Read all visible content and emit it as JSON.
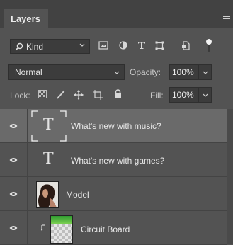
{
  "panel": {
    "tab_label": "Layers"
  },
  "filter": {
    "kind_label": "Kind"
  },
  "blend": {
    "mode": "Normal",
    "opacity_label": "Opacity:",
    "opacity_value": "100%"
  },
  "lock": {
    "label": "Lock:",
    "fill_label": "Fill:",
    "fill_value": "100%"
  },
  "layers": [
    {
      "name": "What's new with music?",
      "type": "text",
      "selected": true
    },
    {
      "name": "What's new with games?",
      "type": "text",
      "selected": false
    },
    {
      "name": "Model",
      "type": "image",
      "selected": false
    },
    {
      "name": "Circuit Board",
      "type": "image-clipped",
      "selected": false
    }
  ],
  "glyphs": {
    "type_tool": "T"
  },
  "colors": {
    "panel_bg": "#535353",
    "selected_row": "#6a6a6a",
    "field_bg": "#3c3c3c"
  }
}
